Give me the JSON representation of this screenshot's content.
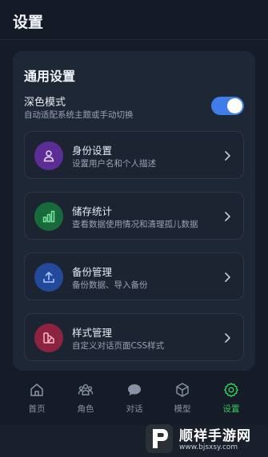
{
  "header": {
    "title": "设置"
  },
  "general": {
    "section_title": "通用设置",
    "dark_mode": {
      "label": "深色模式",
      "description": "自动适配系统主题或手动切换",
      "enabled": true
    },
    "items": [
      {
        "label": "身份设置",
        "description": "设置用户名和个人描述",
        "icon": "user-icon",
        "color": "#7b3fc4"
      },
      {
        "label": "储存统计",
        "description": "查看数据使用情况和清理孤儿数据",
        "icon": "bar-chart-icon",
        "color": "#1f8a4c"
      },
      {
        "label": "备份管理",
        "description": "备份数据、导入备份",
        "icon": "upload-icon",
        "color": "#2f5fc4"
      },
      {
        "label": "样式管理",
        "description": "自定义对话页面CSS样式",
        "icon": "palette-icon",
        "color": "#b4304f"
      }
    ]
  },
  "nav": {
    "active": "设置",
    "items": [
      {
        "label": "首页",
        "icon": "home-icon"
      },
      {
        "label": "角色",
        "icon": "people-icon"
      },
      {
        "label": "对话",
        "icon": "chat-icon"
      },
      {
        "label": "模型",
        "icon": "cube-icon"
      },
      {
        "label": "设置",
        "icon": "gear-icon"
      }
    ]
  },
  "colors": {
    "accent_toggle": "#3f7ee8",
    "active_nav": "#34c759"
  },
  "watermark": {
    "text": "顺祥手游网",
    "url": "www.bjsxsy.com"
  }
}
